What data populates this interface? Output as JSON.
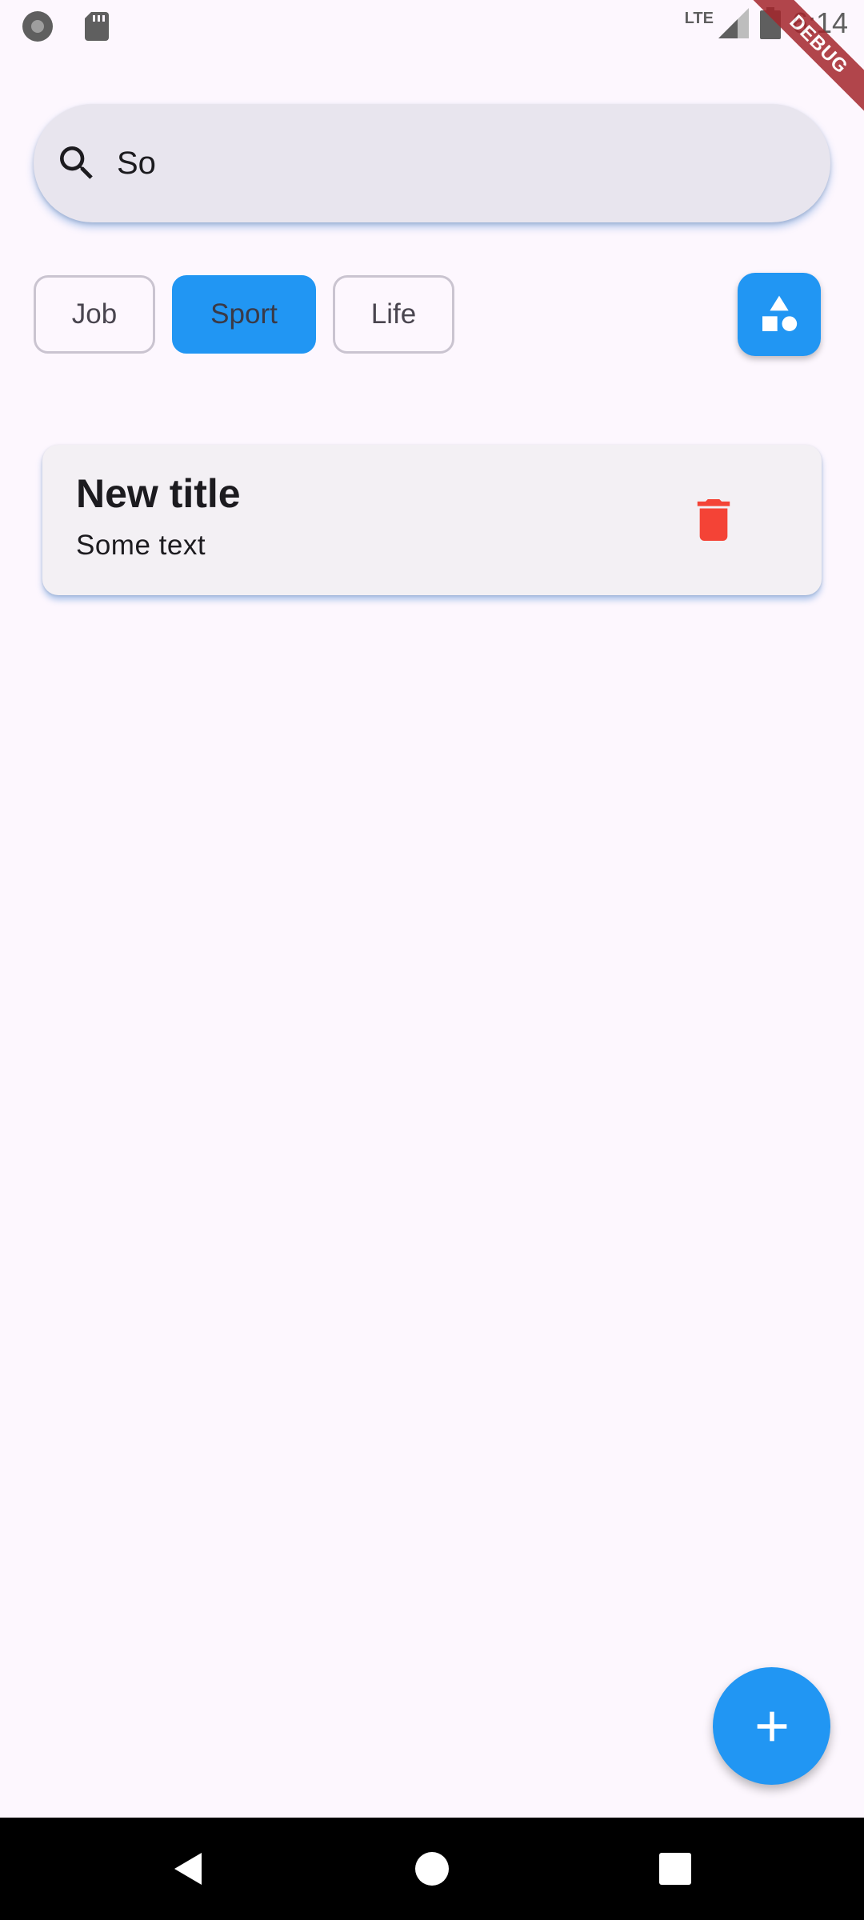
{
  "status_bar": {
    "network_label": "LTE",
    "time": "6:14",
    "icons": [
      "recording-icon",
      "sd-card-icon",
      "signal-icon",
      "battery-icon"
    ]
  },
  "debug_banner": "DEBUG",
  "search": {
    "value": "So",
    "icon": "search-icon"
  },
  "filters": {
    "chips": [
      {
        "label": "Job",
        "selected": false
      },
      {
        "label": "Sport",
        "selected": true
      },
      {
        "label": "Life",
        "selected": false
      }
    ],
    "shapes_button_icon": "shapes-icon"
  },
  "notes": [
    {
      "title": "New title",
      "text": "Some text",
      "action_icon": "trash-icon"
    }
  ],
  "fab_icon": "plus-icon",
  "colors": {
    "accent": "#2196F3",
    "delete": "#F44336",
    "background": "#FDF7FE",
    "card": "#F3F0F4",
    "search_bg": "#E8E5EE"
  },
  "nav_bar": {
    "icons": [
      "back-icon",
      "home-icon",
      "recents-icon"
    ]
  }
}
